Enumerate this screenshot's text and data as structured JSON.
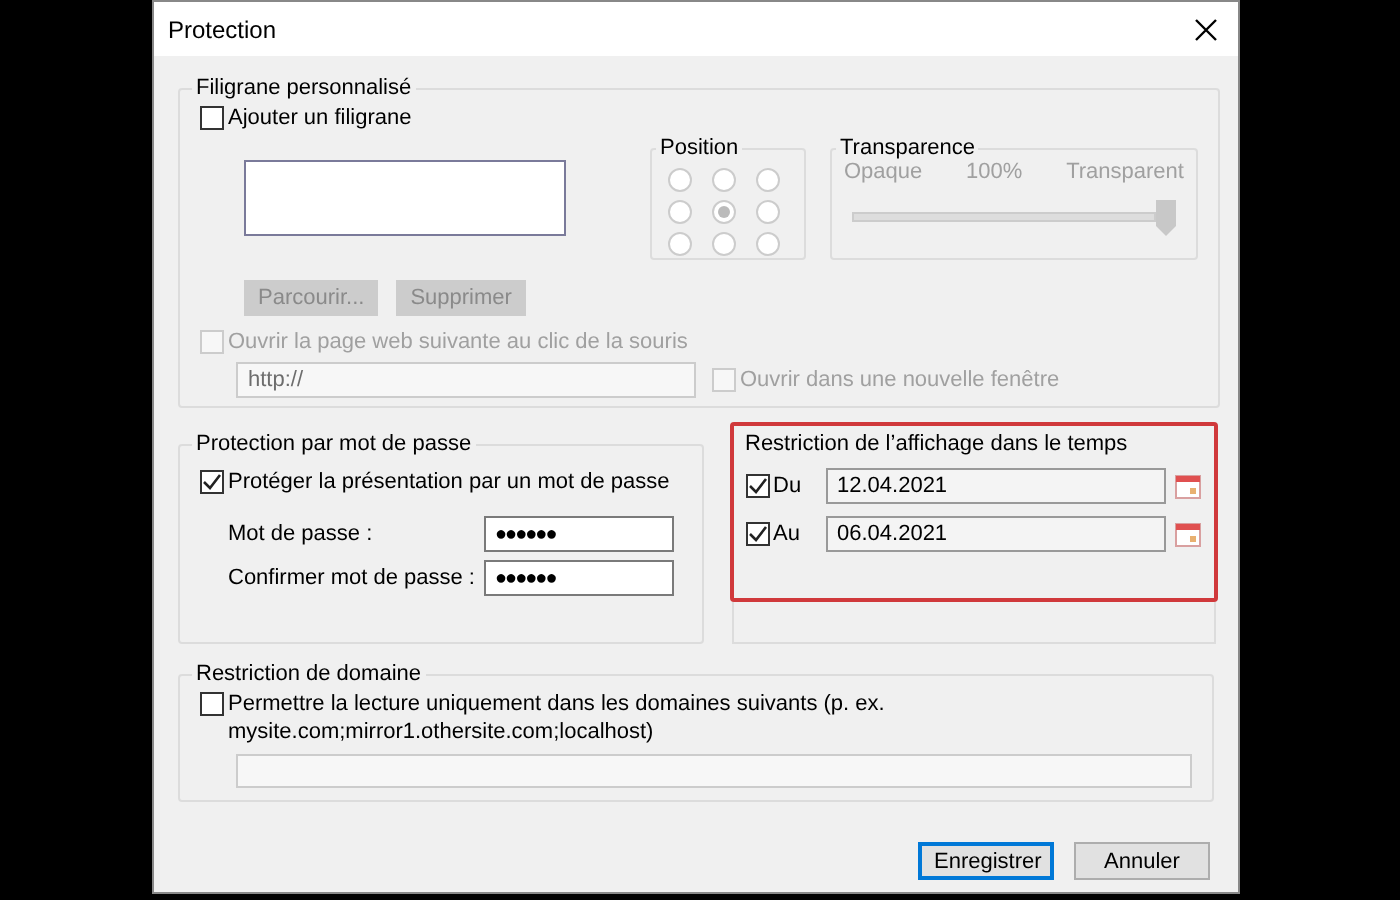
{
  "window": {
    "title": "Protection"
  },
  "watermark": {
    "title": "Filigrane personnalisé",
    "add": {
      "label": "Ajouter un filigrane",
      "checked": false
    },
    "position": {
      "title": "Position",
      "disabled": true,
      "options": [
        {
          "selected": false
        },
        {
          "selected": false
        },
        {
          "selected": false
        },
        {
          "selected": false
        },
        {
          "selected": true
        },
        {
          "selected": false
        },
        {
          "selected": false
        },
        {
          "selected": false
        },
        {
          "selected": false
        }
      ]
    },
    "transparency": {
      "title": "Transparence",
      "disabled": true,
      "min_label": "Opaque",
      "reading": "100%",
      "max_label": "Transparent",
      "level": 1
    },
    "buttons": [
      {
        "label": "Parcourir...",
        "disabled": true
      },
      {
        "label": "Supprimer",
        "disabled": true
      }
    ],
    "open_link": {
      "label": "Ouvrir la page web suivante au clic de la souris",
      "checked": false,
      "disabled": true
    },
    "url": {
      "value": "http://",
      "disabled": true
    },
    "new_window": {
      "label": "Ouvrir dans une nouvelle fenêtre",
      "checked": false,
      "disabled": true
    }
  },
  "password": {
    "title": "Protection par mot de passe",
    "protect": {
      "label": "Protéger la présentation par un mot de passe",
      "checked": true
    },
    "fields": [
      {
        "label": "Mot de passe :",
        "value": "●●●●●●"
      },
      {
        "label": "Confirmer mot de passe :",
        "value": "●●●●●●"
      }
    ]
  },
  "time_restriction": {
    "title": "Restriction de l’affichage dans le temps",
    "highlighted": true,
    "rows": [
      {
        "label": "Du",
        "checked": true,
        "value": "12.04.2021"
      },
      {
        "label": "Au",
        "checked": true,
        "value": "06.04.2021"
      }
    ]
  },
  "domain": {
    "title": "Restriction de domaine",
    "allow": {
      "label": "Permettre la lecture uniquement dans les domaines suivants (p. ex. mysite.com;mirror1.othersite.com;localhost)",
      "checked": false
    }
  },
  "buttons": [
    {
      "label": "Enregistrer",
      "default": true
    },
    {
      "label": "Annuler",
      "default": false
    }
  ]
}
